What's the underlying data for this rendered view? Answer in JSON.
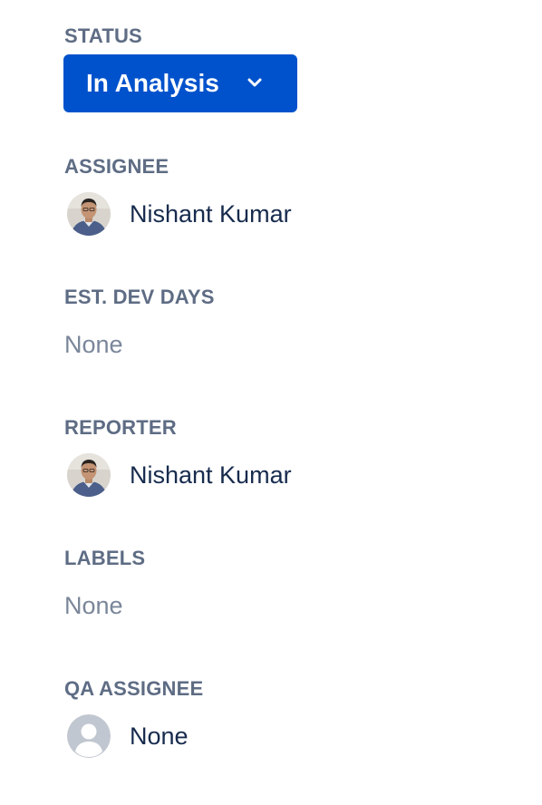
{
  "status": {
    "label": "STATUS",
    "value": "In Analysis",
    "dropdown_icon": "chevron-down-icon",
    "button_color": "#0052cc"
  },
  "assignee": {
    "label": "ASSIGNEE",
    "name": "Nishant Kumar",
    "avatar_icon": "user-photo-avatar"
  },
  "est_dev_days": {
    "label": "EST. DEV DAYS",
    "value": "None"
  },
  "reporter": {
    "label": "REPORTER",
    "name": "Nishant Kumar",
    "avatar_icon": "user-photo-avatar"
  },
  "labels": {
    "label": "LABELS",
    "value": "None"
  },
  "qa_assignee": {
    "label": "QA ASSIGNEE",
    "name": "None",
    "avatar_icon": "default-user-icon"
  },
  "colors": {
    "label_text": "#5e6c84",
    "value_text": "#172b4d",
    "empty_text": "#7a869a"
  }
}
